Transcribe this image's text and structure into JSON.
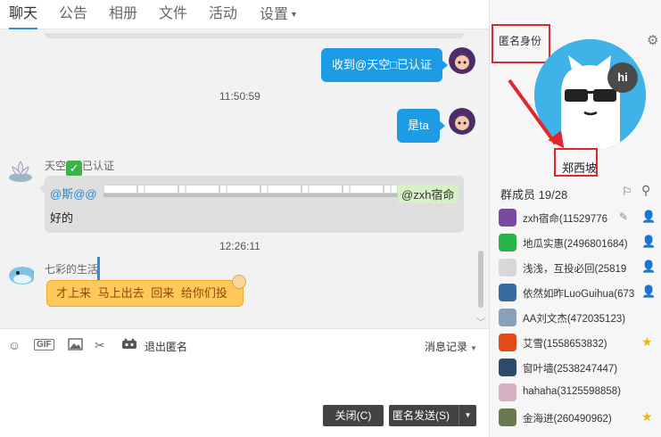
{
  "nav": {
    "tabs": [
      "聊天",
      "公告",
      "相册",
      "文件",
      "活动",
      "设置"
    ],
    "active_tab": "聊天"
  },
  "chat": {
    "msg1": "收到@天空□已认证",
    "time1": "11:50:59",
    "msg2": "是ta",
    "sender1": "天空",
    "sender1_suffix": "已认证",
    "mention": "@斯@@",
    "mention_tag": "@zxh宿命",
    "reply": "好的",
    "time2": "12:26:11",
    "sender2": "七彩的生活",
    "msg3": "才上来  马上出去  回来 给你们投"
  },
  "toolbar": {
    "gif": "GIF",
    "exit_anon": "退出匿名",
    "history": "消息记录"
  },
  "buttons": {
    "close": "关闭(C)",
    "send": "匿名发送(S)"
  },
  "right_panel": {
    "anon_title": "匿名身份",
    "hi": "hi",
    "anon_name": "郑西坡",
    "members_label": "群成员",
    "members_count": "19/28",
    "members": [
      {
        "name": "zxh宿命(11529776",
        "badge": "person-icon",
        "color": "#7a4aa0"
      },
      {
        "name": "地瓜实惠(2496801684)",
        "badge": "person-icon",
        "color": "#27b24a"
      },
      {
        "name": "浅浅，互投必回(25819",
        "badge": "person-icon",
        "color": "#d8d8d8"
      },
      {
        "name": "依然如昨LuoGuihua(673",
        "badge": "person-icon",
        "color": "#3a6b9e"
      },
      {
        "name": "AA刘文杰(472035123)",
        "badge": "",
        "color": "#8aa0b8"
      },
      {
        "name": "艾雪(1558653832)",
        "badge": "star-icon",
        "color": "#e04a18"
      },
      {
        "name": "窗叶墙(2538247447)",
        "badge": "",
        "color": "#2c4a6a"
      },
      {
        "name": "hahaha(3125598858)",
        "badge": "",
        "color": "#d4b0c0"
      },
      {
        "name": "金海进(260490962)",
        "badge": "star-icon",
        "color": "#6a7a50"
      }
    ]
  },
  "colors": {
    "accent": "#2f8ddf",
    "bubble_blue": "#1d9ce5",
    "annotation_red": "#e0262a"
  }
}
